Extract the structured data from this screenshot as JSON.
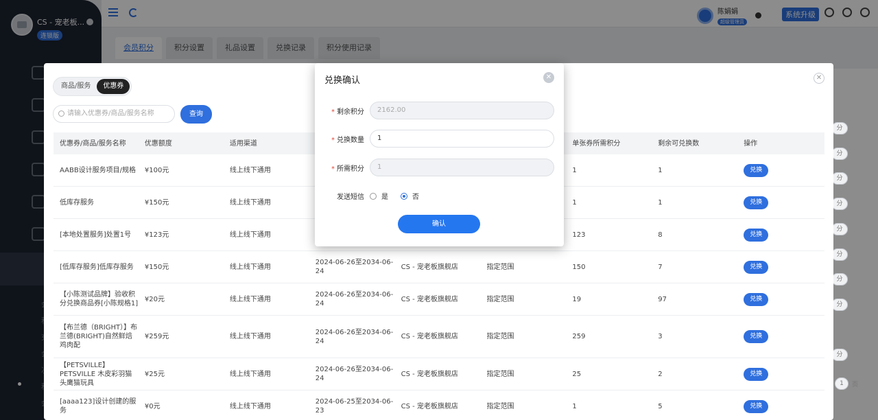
{
  "sidebar": {
    "store_name": "CS - 宠老板...",
    "store_badge": "连锁版",
    "sub_items": [
      "会",
      "积",
      "充",
      "会",
      "次",
      "积",
      "会"
    ]
  },
  "topbar": {
    "user_name": "陈娟娟",
    "user_role": "超级管理员",
    "upgrade_label": "系统升级"
  },
  "tabs": [
    "会员积分",
    "积分设置",
    "礼品设置",
    "兑换记录",
    "积分使用记录"
  ],
  "panel": {
    "segments": [
      "商品/服务",
      "优惠券"
    ],
    "search_placeholder": "请输入优惠券/商品/服务名称",
    "search_button": "查询",
    "columns": [
      "优惠券/商品/服务名称",
      "优惠额度",
      "适用渠道",
      "",
      "",
      "",
      "单张券所需积分",
      "剩余可兑换数",
      "操作"
    ],
    "rows": [
      {
        "name": "AABB设计服务项目/规格",
        "amount": "¥100元",
        "channel": "线上线下通用",
        "period": "",
        "store": "",
        "scope": "",
        "points": "1",
        "remaining": "1",
        "action": "兑换"
      },
      {
        "name": "低库存服务",
        "amount": "¥150元",
        "channel": "线上线下通用",
        "period": "",
        "store": "",
        "scope": "",
        "points": "1",
        "remaining": "1",
        "action": "兑换"
      },
      {
        "name": "[本地处置服务]处置1号",
        "amount": "¥123元",
        "channel": "线上线下通用",
        "period": "",
        "store": "",
        "scope": "",
        "points": "123",
        "remaining": "8",
        "action": "兑换"
      },
      {
        "name": "[低库存服务]低库存服务",
        "amount": "¥150元",
        "channel": "线上线下通用",
        "period": "2024-06-26至2034-06-24",
        "store": "CS - 宠老板旗舰店",
        "scope": "指定范围",
        "points": "150",
        "remaining": "7",
        "action": "兑换"
      },
      {
        "name": "【小陈测试品牌】验收积分兑换商品券[小陈规格1]",
        "amount": "¥20元",
        "channel": "线上线下通用",
        "period": "2024-06-26至2034-06-24",
        "store": "CS - 宠老板旗舰店",
        "scope": "指定范围",
        "points": "19",
        "remaining": "97",
        "action": "兑换"
      },
      {
        "name": "【布兰德（BRIGHT）】布兰德(BRIGHT)自然鲜焙 鸡肉配",
        "amount": "¥259元",
        "channel": "线上线下通用",
        "period": "2024-06-26至2034-06-24",
        "store": "CS - 宠老板旗舰店",
        "scope": "指定范围",
        "points": "259",
        "remaining": "3",
        "action": "兑换"
      },
      {
        "name": "【PETSVILLE】PETSVILLE 木皮彩羽猫头鹰猫玩具",
        "amount": "¥25元",
        "channel": "线上线下通用",
        "period": "2024-06-26至2034-06-24",
        "store": "CS - 宠老板旗舰店",
        "scope": "指定范围",
        "points": "25",
        "remaining": "2",
        "action": "兑换"
      },
      {
        "name": "[aaaa123]设计创建的服务",
        "amount": "¥0元",
        "channel": "线上线下通用",
        "period": "2024-06-25至2034-06-23",
        "store": "CS - 宠老板旗舰店",
        "scope": "指定范围",
        "points": "1",
        "remaining": "5",
        "action": "兑换"
      }
    ],
    "ghost_buttons": [
      "分",
      "分",
      "分",
      "分",
      "分",
      "分",
      "分",
      "分",
      "分"
    ],
    "pager_value": "1",
    "pager_suffix": "页"
  },
  "modal": {
    "title": "兑换确认",
    "fields": [
      {
        "label": "剩余积分",
        "value": "2162.00",
        "disabled": true
      },
      {
        "label": "兑换数量",
        "value": "1",
        "disabled": false
      },
      {
        "label": "所需积分",
        "value": "1",
        "disabled": true
      }
    ],
    "sms_label": "发送短信",
    "sms_options": [
      "是",
      "否"
    ],
    "sms_selected": "否",
    "confirm_label": "确认"
  }
}
